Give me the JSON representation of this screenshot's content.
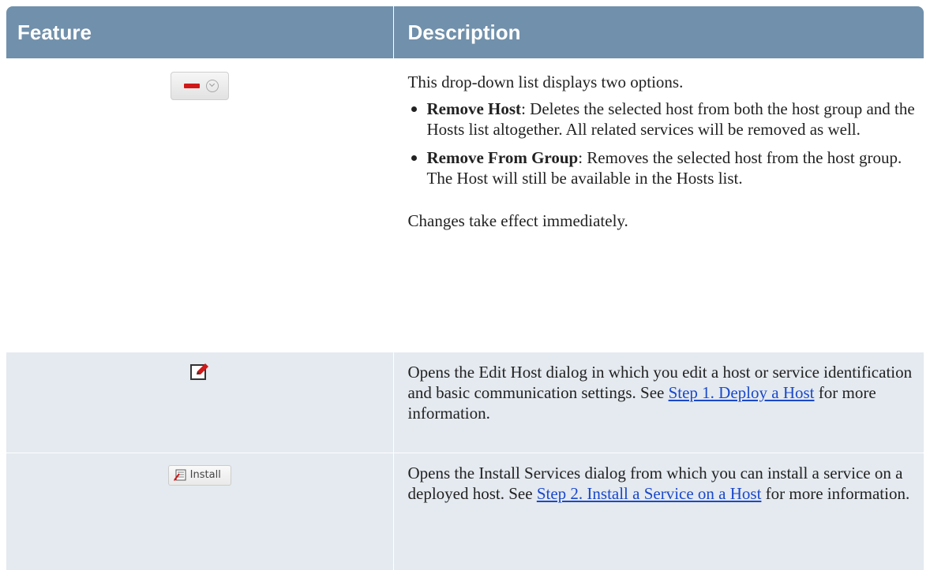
{
  "table": {
    "headers": {
      "feature": "Feature",
      "description": "Description"
    },
    "rows": {
      "remove": {
        "intro": "This drop-down list displays two options.",
        "options": [
          {
            "term": "Remove Host",
            "text": ": Deletes the selected host from both the host group and the Hosts list altogether. All related services will be removed as well."
          },
          {
            "term": "Remove From Group",
            "text": ": Removes the selected host from the host group. The Host will still be available in the Hosts list."
          }
        ],
        "outro": "Changes take effect immediately."
      },
      "edit": {
        "text_before": "Opens the Edit Host dialog in which you edit a host or service identification and basic communication settings. See ",
        "link": "Step 1. Deploy a Host",
        "text_after": " for more information."
      },
      "install": {
        "button_label": "Install",
        "text_before": "Opens the Install Services dialog from which you can install a service on a deployed host. See ",
        "link": "Step 2. Install a Service on a Host",
        "text_after": " for more information."
      }
    }
  },
  "icons": {
    "remove": "remove-minus-icon",
    "dropdown": "chevron-down-icon",
    "edit": "edit-pencil-icon",
    "install": "install-icon"
  },
  "colors": {
    "header_bg": "#7190ab",
    "row_alt_bg": "#e4eaf0",
    "link": "#1b48c9",
    "remove_red": "#d01818"
  }
}
